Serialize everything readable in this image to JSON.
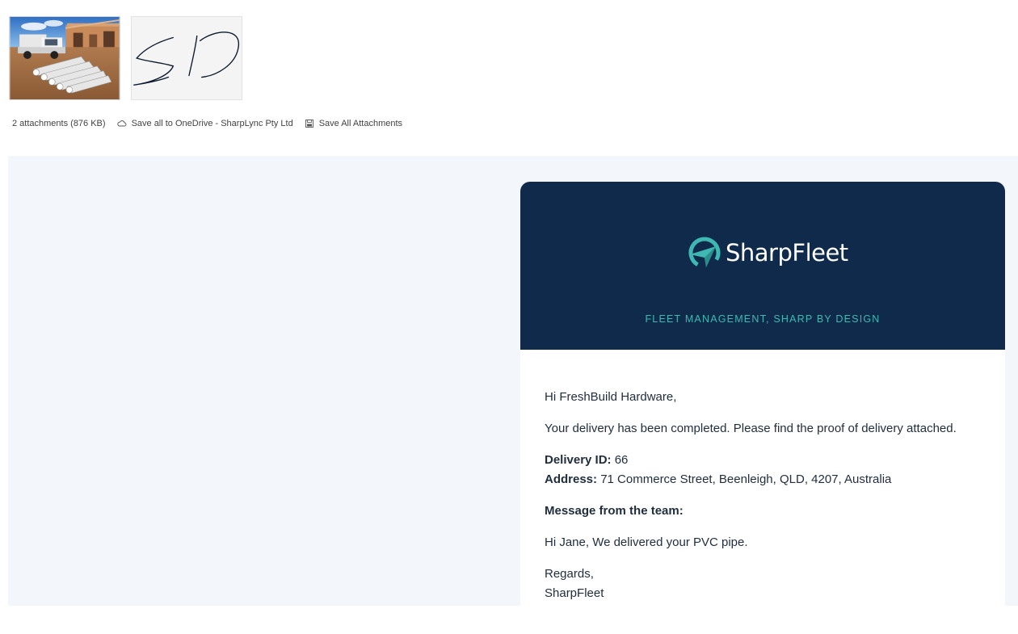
{
  "attachments": {
    "count_text": "2 attachments (876 KB)",
    "save_onedrive_label": "Save all to OneDrive - SharpLync Pty Ltd",
    "save_all_label": "Save All Attachments",
    "icons": [
      "cloud-icon",
      "save-icon"
    ]
  },
  "email": {
    "brand_name": "SharpFleet",
    "tagline": "FLEET MANAGEMENT, SHARP BY DESIGN",
    "greeting": "Hi FreshBuild Hardware,",
    "intro": "Your delivery has been completed. Please find the proof of delivery attached.",
    "delivery_id_label": "Delivery ID:",
    "delivery_id_value": "66",
    "address_label": "Address:",
    "address_value": "71 Commerce Street, Beenleigh, QLD, 4207, Australia",
    "message_heading": "Message from the team:",
    "message_text": "Hi Jane, We delivered your PVC pipe.",
    "regards": "Regards,",
    "signoff": "SharpFleet"
  },
  "colors": {
    "header_bg": "#0f2a4a",
    "accent_teal": "#3fb8b3",
    "email_area_bg": "#f3f6fa"
  }
}
